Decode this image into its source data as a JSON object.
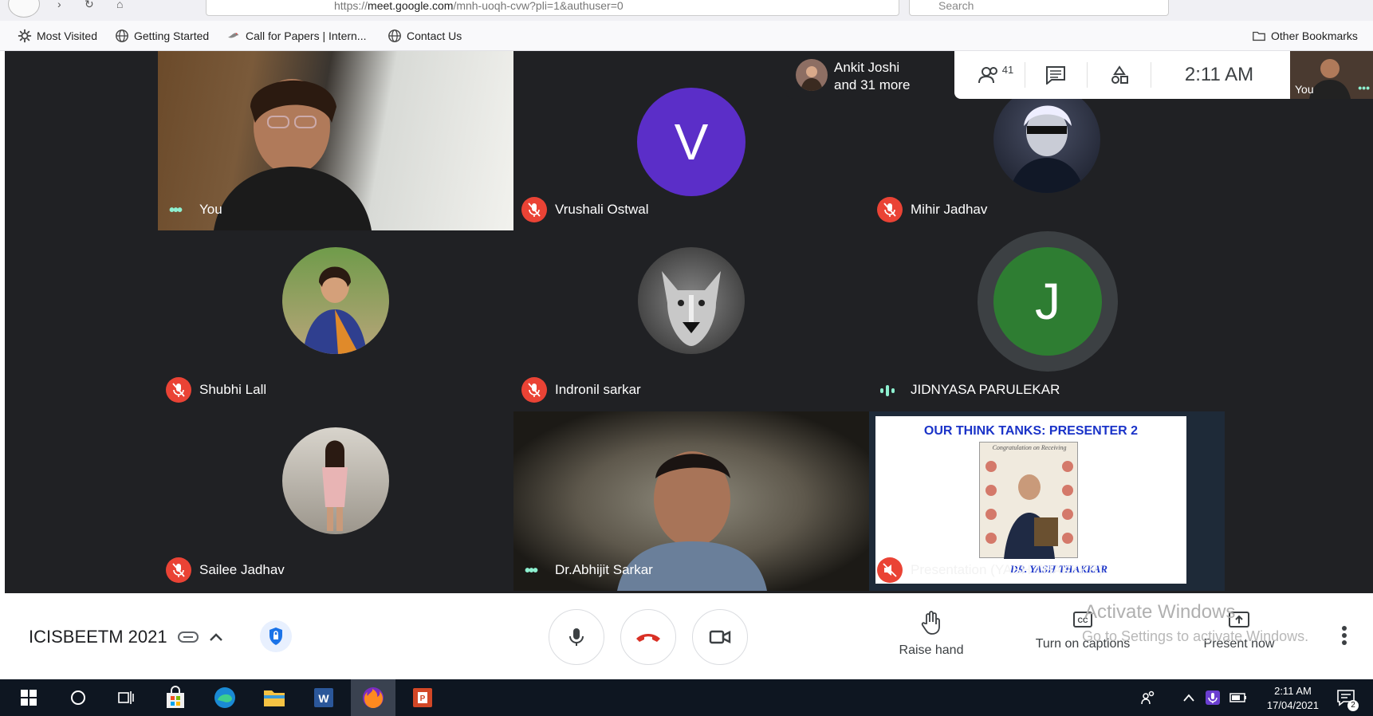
{
  "browser": {
    "url_prefix": "https://",
    "url_host": "meet.google.com",
    "url_rest": "/mnh-uoqh-cvw?pli=1&authuser=0",
    "search_placeholder": "Search"
  },
  "bookmarks": {
    "items": [
      {
        "label": "Most Visited",
        "icon": "gear-icon"
      },
      {
        "label": "Getting Started",
        "icon": "globe-icon"
      },
      {
        "label": "Call for Papers | Intern...",
        "icon": "bird-icon"
      },
      {
        "label": "Contact Us",
        "icon": "globe-icon"
      }
    ],
    "other": "Other Bookmarks"
  },
  "meet": {
    "presenting_card": {
      "line1": "Ankit Joshi",
      "line2": "and 31 more"
    },
    "participant_count": "41",
    "clock": "2:11 AM",
    "self_mini_label": "You",
    "tiles": [
      {
        "name": "You",
        "type": "video-self",
        "status": "dots"
      },
      {
        "name": "Vrushali Ostwal",
        "type": "letter",
        "letter": "V",
        "color": "#5b2ec8",
        "status": "muted"
      },
      {
        "name": "Mihir Jadhav",
        "type": "photo",
        "status": "muted"
      },
      {
        "name": "Shubhi Lall",
        "type": "photo",
        "status": "muted"
      },
      {
        "name": "Indronil sarkar",
        "type": "photo",
        "status": "muted"
      },
      {
        "name": "JIDNYASA PARULEKAR",
        "type": "letter",
        "letter": "J",
        "color": "#2e7d32",
        "status": "speaking"
      },
      {
        "name": "Sailee Jadhav",
        "type": "photo",
        "status": "muted"
      },
      {
        "name": "Dr.Abhijit Sarkar",
        "type": "video",
        "status": "dots"
      },
      {
        "name": "Presentation (YASH THAKKER)",
        "type": "presentation",
        "status": "muted-speaker"
      }
    ],
    "slide": {
      "title": "OUR THINK TANKS: PRESENTER 2",
      "caption": "DR. YASH THAKKAR",
      "certificate_text": "Congratulation on Receiving"
    }
  },
  "controls": {
    "meeting_name": "ICISBEETM 2021",
    "raise_hand": "Raise hand",
    "captions": "Turn on captions",
    "present": "Present now",
    "watermark_title": "Activate Windows",
    "watermark_sub": "Go to Settings to activate Windows."
  },
  "taskbar": {
    "time": "2:11 AM",
    "date": "17/04/2021",
    "notifications": "2"
  }
}
